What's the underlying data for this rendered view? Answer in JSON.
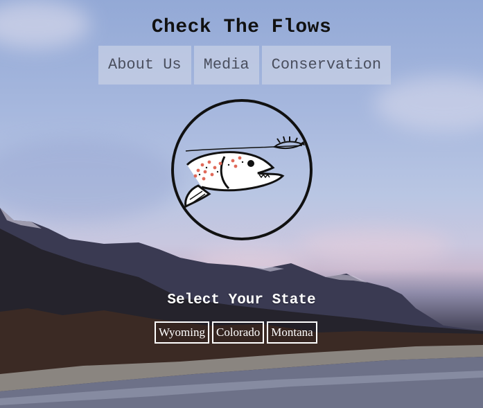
{
  "header": {
    "title": "Check The Flows"
  },
  "nav": {
    "items": [
      {
        "label": "About Us"
      },
      {
        "label": "Media"
      },
      {
        "label": "Conservation"
      }
    ]
  },
  "logo": {
    "icon": "trout-fly-logo-icon"
  },
  "state_selector": {
    "title": "Select Your State",
    "states": [
      {
        "label": "Wyoming"
      },
      {
        "label": "Colorado"
      },
      {
        "label": "Montana"
      }
    ]
  },
  "background": {
    "description_icon": "mountain-river-landscape"
  }
}
